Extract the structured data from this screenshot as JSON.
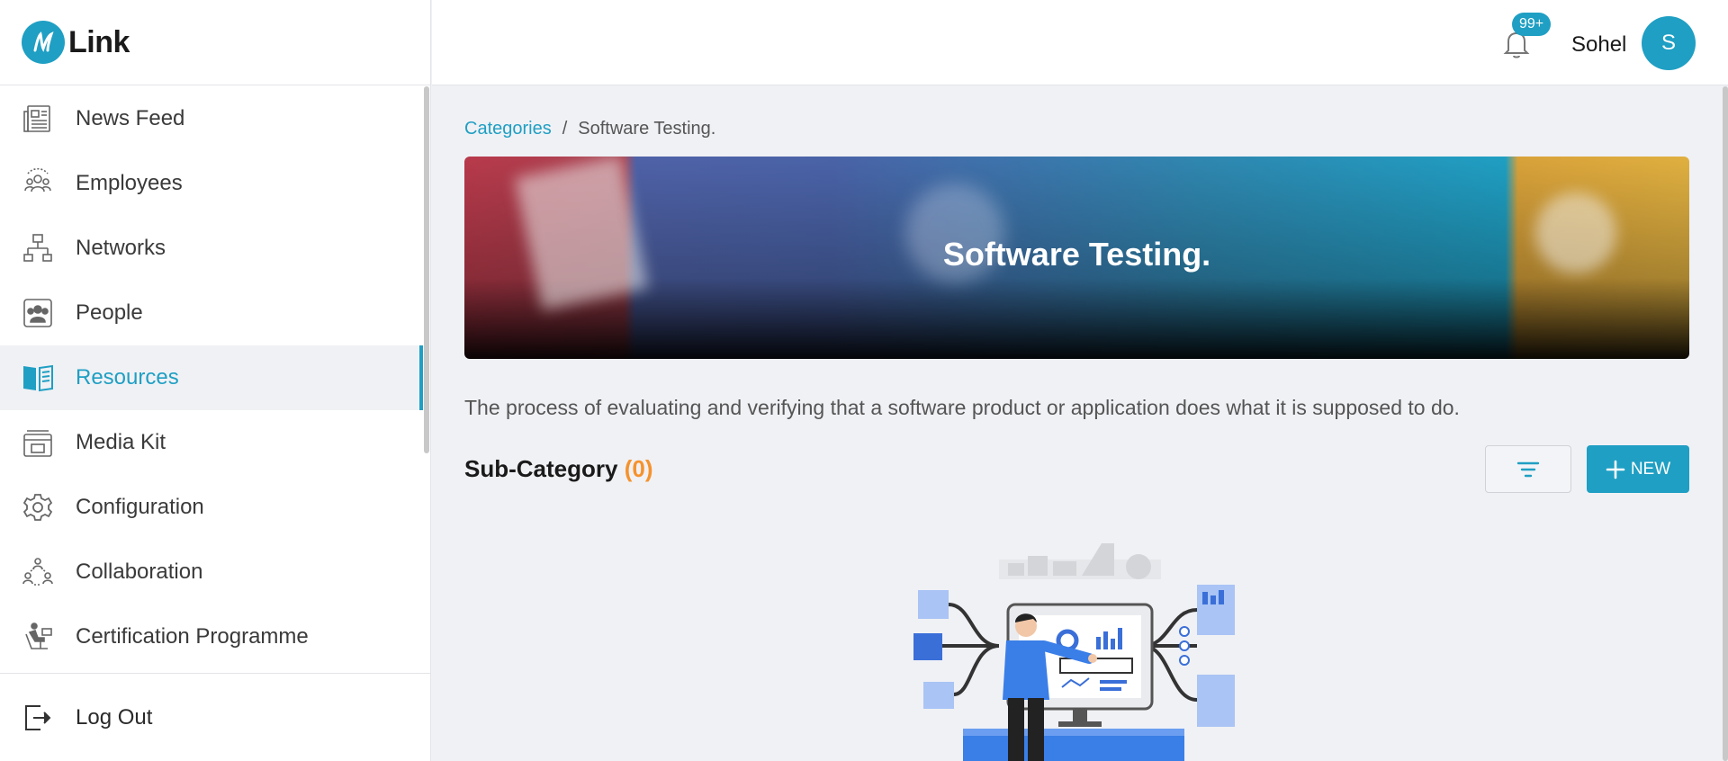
{
  "app": {
    "logo_text": "Link"
  },
  "sidebar": {
    "items": [
      {
        "label": "News Feed",
        "icon": "newspaper-icon"
      },
      {
        "label": "Employees",
        "icon": "employees-icon"
      },
      {
        "label": "Networks",
        "icon": "network-icon"
      },
      {
        "label": "People",
        "icon": "people-icon"
      },
      {
        "label": "Resources",
        "icon": "book-icon",
        "active": true
      },
      {
        "label": "Media Kit",
        "icon": "media-kit-icon"
      },
      {
        "label": "Configuration",
        "icon": "gear-icon"
      },
      {
        "label": "Collaboration",
        "icon": "collaboration-icon"
      },
      {
        "label": "Certification Programme",
        "icon": "certification-icon"
      }
    ],
    "logout_label": "Log Out"
  },
  "topbar": {
    "notification_badge": "99+",
    "user_name": "Sohel",
    "avatar_initial": "S"
  },
  "breadcrumb": {
    "parent": "Categories",
    "separator": "/",
    "current": "Software Testing."
  },
  "banner": {
    "title": "Software Testing."
  },
  "description": "The process of evaluating and verifying that a software product or application does what it is supposed to do.",
  "subcategory": {
    "title": "Sub-Category",
    "count": "(0)"
  },
  "actions": {
    "new_label": "NEW"
  },
  "colors": {
    "accent": "#1f9fc3",
    "count": "#f5922d"
  }
}
